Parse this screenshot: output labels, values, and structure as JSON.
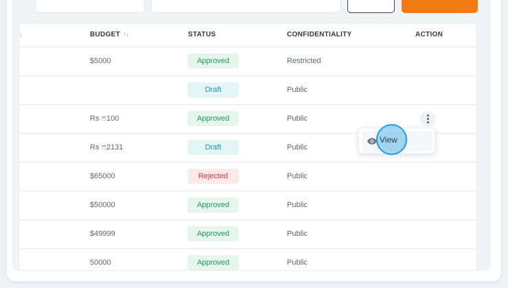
{
  "table": {
    "columns": {
      "budget": "BUDGET",
      "status": "STATUS",
      "confidentiality": "CONFIDENTIALITY",
      "action": "ACTION"
    },
    "sort_glyph": "↑↓",
    "partial_sort_glyph": "↓",
    "rows": [
      {
        "budget": "$5000",
        "status": "Approved",
        "confidentiality": "Restricted"
      },
      {
        "budget": "",
        "status": "Draft",
        "confidentiality": "Public"
      },
      {
        "budget": "Rs ෆ100",
        "status": "Approved",
        "confidentiality": "Public"
      },
      {
        "budget": "Rs ෆ2131",
        "status": "Draft",
        "confidentiality": "Public"
      },
      {
        "budget": "$65000",
        "status": "Rejected",
        "confidentiality": "Public"
      },
      {
        "budget": "$50000",
        "status": "Approved",
        "confidentiality": "Public"
      },
      {
        "budget": "$49999",
        "status": "Approved",
        "confidentiality": "Public"
      },
      {
        "budget": "50000",
        "status": "Approved",
        "confidentiality": "Public"
      }
    ]
  },
  "action_menu": {
    "view_label": "View",
    "view_icon": "eye-icon"
  },
  "colors": {
    "accent": "#f37a12",
    "approved": "#1e9b5a",
    "draft": "#1a9aa3",
    "rejected": "#d4364a"
  }
}
